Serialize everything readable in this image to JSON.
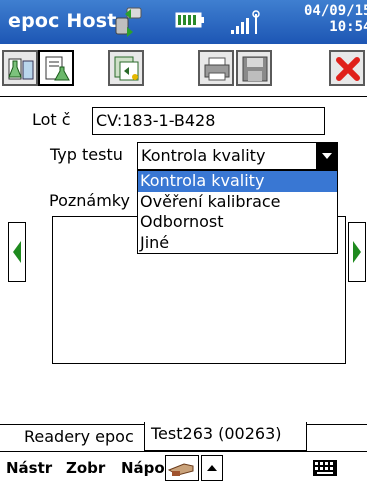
{
  "titlebar": {
    "title": "epoc Host",
    "date": "04/09/15",
    "time": "10:54"
  },
  "toolbar": {
    "buttons": [
      "reagent-icon",
      "flask-icon",
      "document-icon",
      "printer-icon",
      "floppy-disk-icon",
      "close-icon"
    ]
  },
  "form": {
    "lot_label": "Lot č",
    "lot_value": "CV:183-1-B428",
    "test_type_label": "Typ testu",
    "test_type_value": "Kontrola kvality",
    "notes_label": "Poznámky",
    "options": [
      "Kontrola kvality",
      "Ověření kalibrace",
      "Odbornost",
      "Jiné"
    ]
  },
  "tabs": [
    "Readery epoc",
    "Test263 (00263)"
  ],
  "menubar": {
    "items": [
      "Nástr",
      "Zobr",
      "Nápo"
    ]
  },
  "colors": {
    "title_bg": "#1d56b4",
    "selection": "#3977d3",
    "close_red": "#e0201a",
    "nav_green": "#1e8a1e"
  }
}
